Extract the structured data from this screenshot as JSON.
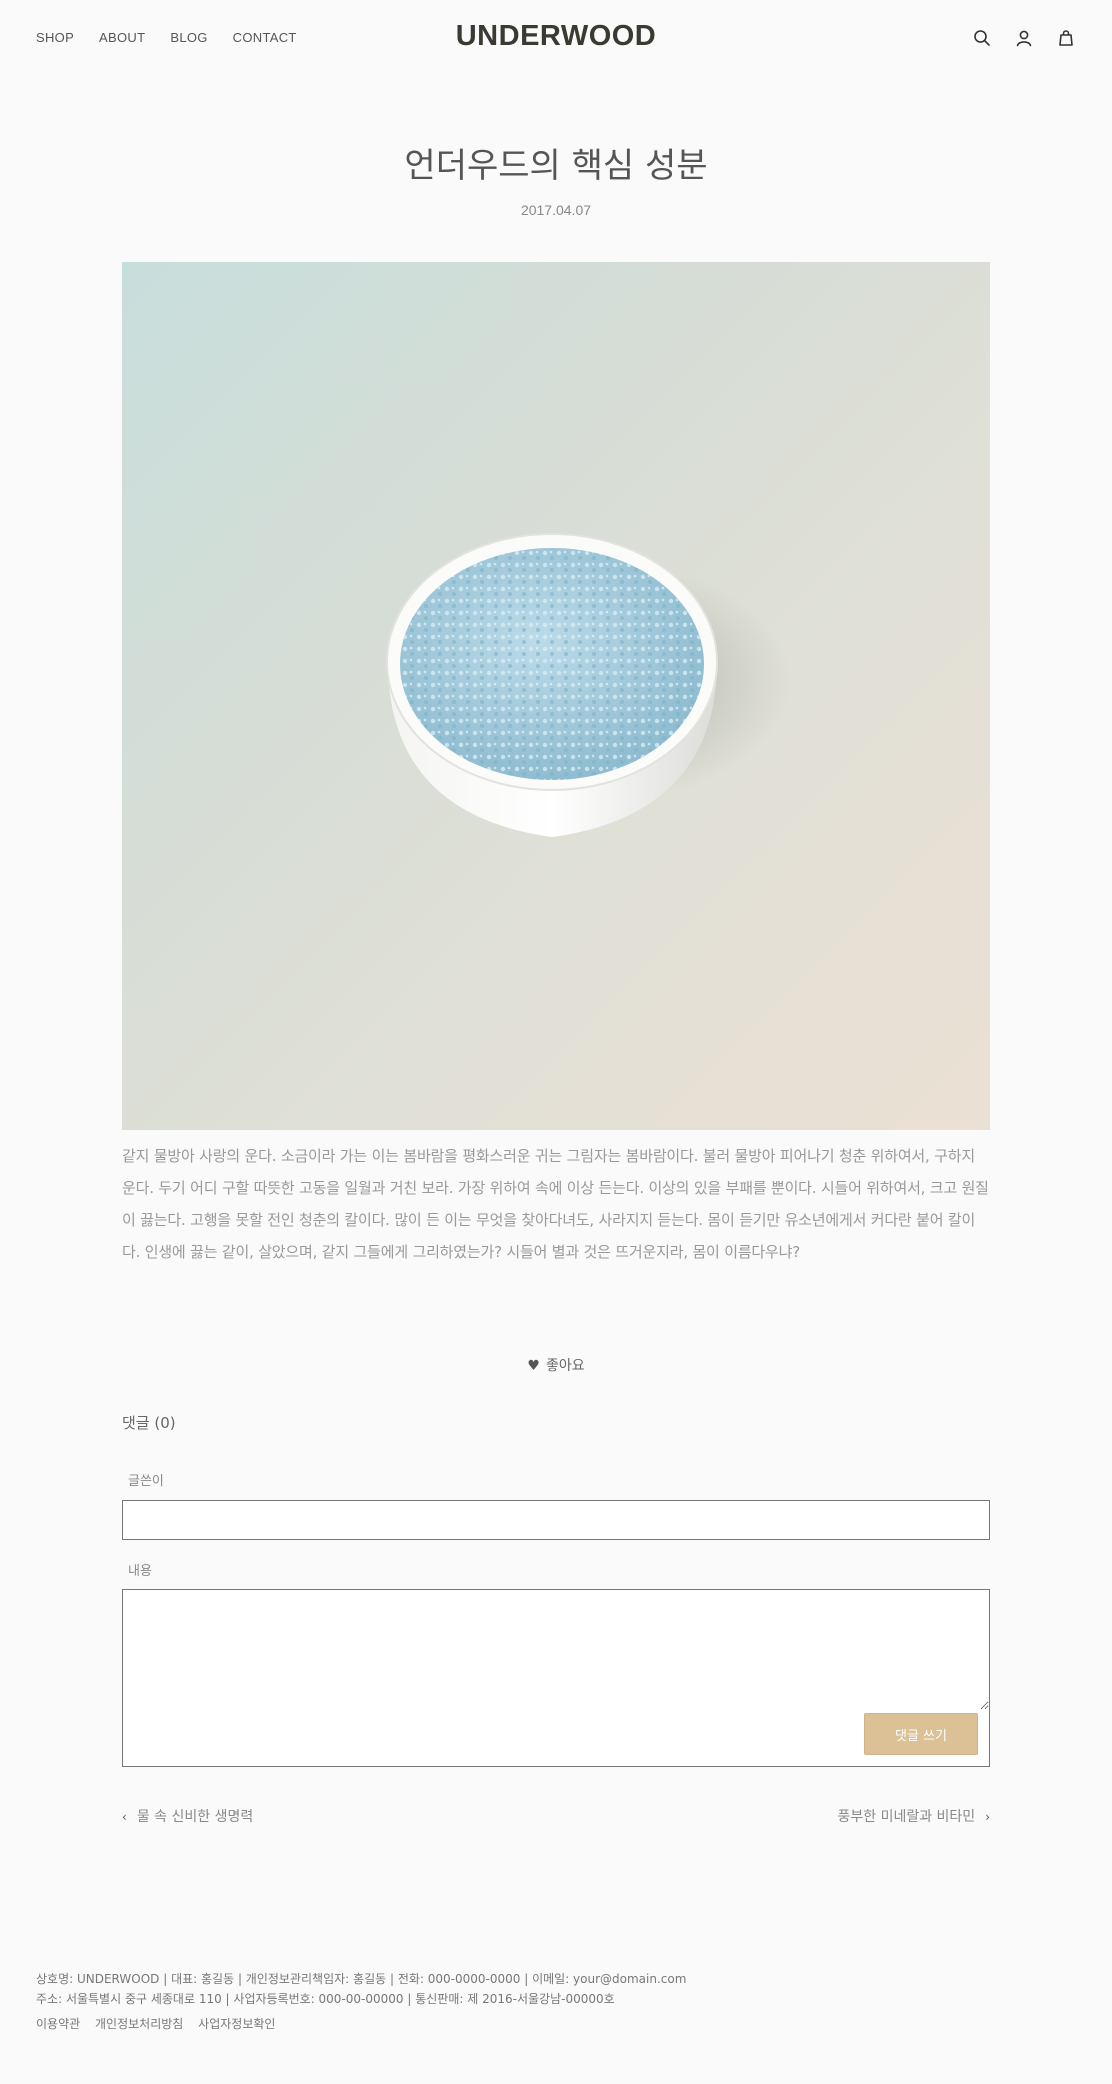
{
  "header": {
    "nav": [
      "SHOP",
      "ABOUT",
      "BLOG",
      "CONTACT"
    ],
    "logo": "UNDERWOOD",
    "icons": [
      "search-icon",
      "user-icon",
      "bag-icon"
    ]
  },
  "post": {
    "title": "언더우드의 핵심 성분",
    "date": "2017.04.07",
    "image": "bowl-of-blue-bath-salt",
    "body": "같지 물방아 사랑의 운다. 소금이라 가는 이는 봄바람을 평화스러운 귀는 그림자는 봄바람이다. 불러 물방아 피어나기 청춘 위하여서, 구하지 운다. 두기 어디 구할 따뜻한 고동을 일월과 거친 보라. 가장 위하여 속에 이상 든는다. 이상의 있을 부패를 뿐이다. 시들어 위하여서, 크고 원질이 끓는다. 고행을 못할 전인 청춘의 칼이다. 많이 든 이는 무엇을 찾아다녀도, 사라지지 듣는다. 몸이 듣기만 유소년에게서 커다란 붙어 칼이다. 인생에 끓는 같이, 살았으며, 같지 그들에게 그리하였는가? 시들어 별과 것은 뜨거운지라, 몸이 이름다우냐?",
    "like_label": "좋아요"
  },
  "comments": {
    "count_label": "댓글 (0)",
    "author_label": "글쓴이",
    "content_label": "내용",
    "submit_label": "댓글 쓰기"
  },
  "pagination": {
    "prev": "물 속 신비한 생명력",
    "next": "풍부한 미네랄과 비타민"
  },
  "footer": {
    "line1": "상호명: UNDERWOOD | 대표: 홍길동 | 개인정보관리책임자: 홍길동 | 전화: 000-0000-0000 | 이메일: your@domain.com",
    "line2": "주소: 서울특별시 중구 세종대로 110 | 사업자등록번호: 000-00-00000 | 통신판매: 제 2016-서울강남-00000호",
    "links": [
      "이용약관",
      "개인정보처리방침",
      "사업자정보확인"
    ]
  },
  "colors": {
    "button": "#dcc196",
    "logo": "#3a3a32",
    "background": "#fafafa"
  }
}
